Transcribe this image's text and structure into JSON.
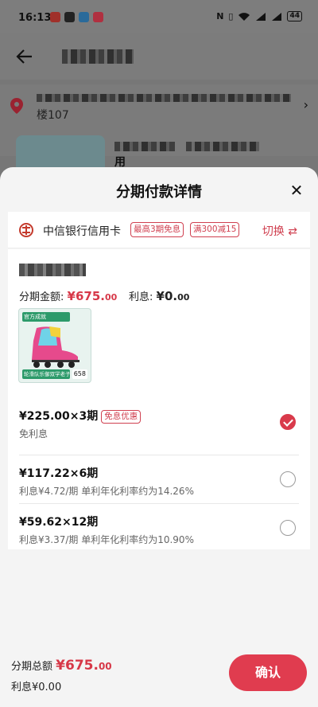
{
  "status_bar": {
    "time": "16:13",
    "battery": "44"
  },
  "background": {
    "address_suffix": "楼107",
    "product_suffix": "用"
  },
  "sheet": {
    "title": "分期付款详情",
    "card": {
      "bank_name": "中信银行信用卡",
      "tags": [
        "最高3期免息",
        "满300减15"
      ],
      "switch_label": "切换 ⇄"
    },
    "summary": {
      "amount_label": "分期金额:",
      "amount_main": "¥675.",
      "amount_cents": "00",
      "interest_label": "利息:",
      "interest_main": "¥0.",
      "interest_cents": "00"
    },
    "thumb": {
      "top_text": "官方成就",
      "bottom_text": "轮滑队乐御双学老子",
      "badge": "658"
    },
    "options": [
      {
        "main": "¥225.00×3期",
        "tag": "免息优惠",
        "sub": "免利息",
        "selected": true
      },
      {
        "main": "¥117.22×6期",
        "tag": "",
        "sub": "利息¥4.72/期 单利年化利率约为14.26%",
        "selected": false
      },
      {
        "main": "¥59.62×12期",
        "tag": "",
        "sub": "利息¥3.37/期 单利年化利率约为10.90%",
        "selected": false
      }
    ]
  },
  "footer": {
    "total_label": "分期总额",
    "total_main": "¥675.",
    "total_cents": "00",
    "interest_text": "利息¥0.00",
    "confirm_label": "确认"
  },
  "colors": {
    "accent": "#d93a4b",
    "overlay": "#7f7f7f"
  }
}
